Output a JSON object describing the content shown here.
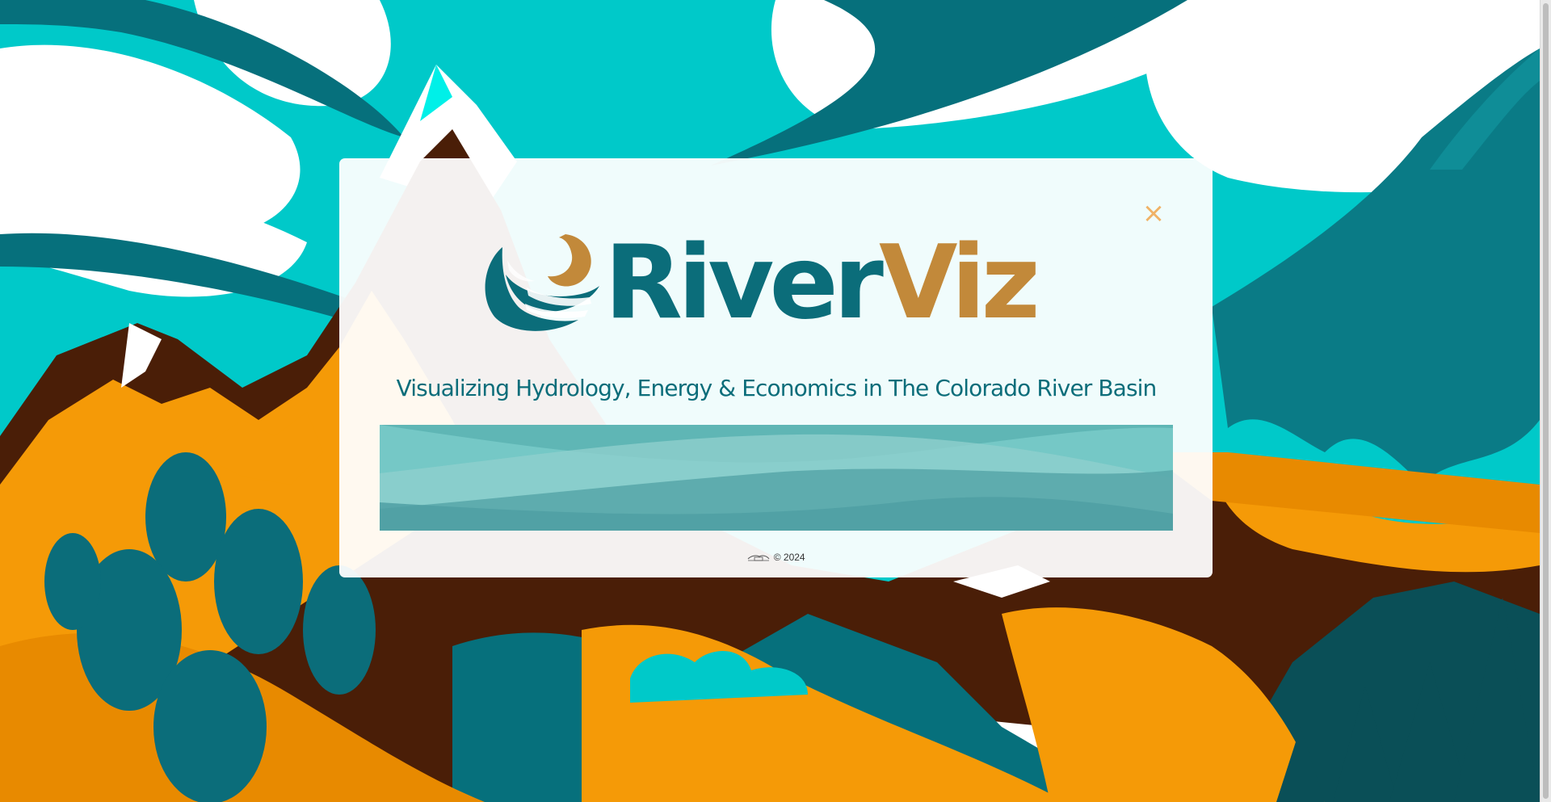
{
  "app": {
    "name_part_1": "River",
    "name_part_2": "Viz",
    "tagline": "Visualizing Hydrology, Energy & Economics in The Colorado River Basin"
  },
  "modal": {
    "close_icon": "close-icon",
    "close_glyph": "×"
  },
  "footer": {
    "logo_icon": "partner-logo-icon",
    "copyright": "© 2024"
  },
  "colors": {
    "teal": "#0b6d7a",
    "gold": "#c2893a",
    "sky": "#00c9c9",
    "orange": "#f59a07",
    "brown": "#4a1e07"
  },
  "background": {
    "description_icon": "mountain-landscape-illustration"
  }
}
